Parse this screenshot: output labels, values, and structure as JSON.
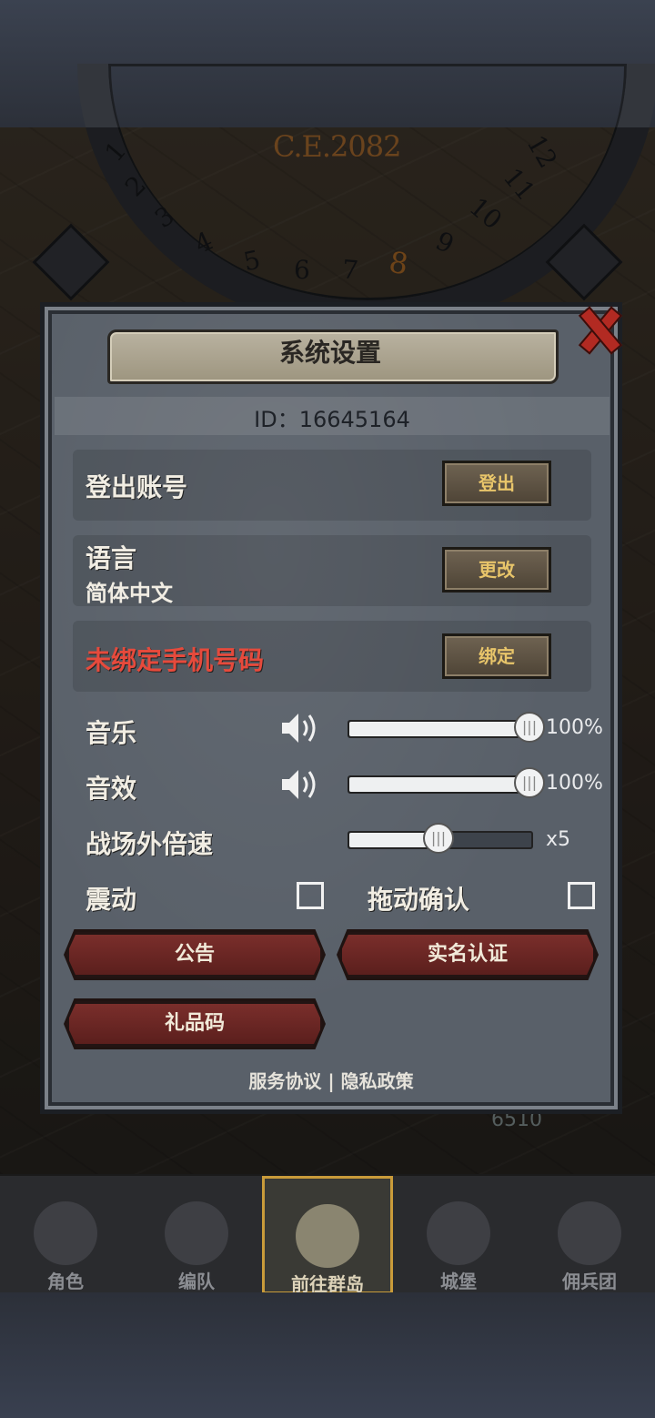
{
  "hud": {
    "era": "C.E.2082",
    "dial_numbers": [
      "1",
      "2",
      "3",
      "4",
      "5",
      "6",
      "7",
      "8",
      "9",
      "10",
      "11",
      "12"
    ],
    "current_month": "8",
    "resource_value": "6510"
  },
  "dialog": {
    "title": "系统设置",
    "id_text": "ID：16645164",
    "rows": {
      "logout": {
        "label": "登出账号",
        "button": "登出"
      },
      "language": {
        "label": "语言",
        "value": "简体中文",
        "button": "更改"
      },
      "phone": {
        "label": "未绑定手机号码",
        "button": "绑定"
      }
    },
    "music": {
      "label": "音乐",
      "level_percent": 100,
      "value_text": "100%"
    },
    "sfx": {
      "label": "音效",
      "level_percent": 100,
      "value_text": "100%"
    },
    "speed": {
      "label": "战场外倍速",
      "level_fraction": 0.5,
      "value_text": "x5"
    },
    "vibrate": {
      "label": "震动",
      "checked": false
    },
    "drag_confirm": {
      "label": "拖动确认",
      "checked": false
    },
    "buttons": {
      "notice": "公告",
      "real_name": "实名认证",
      "gift_code": "礼品码"
    },
    "links": {
      "terms": "服务协议",
      "separator": "|",
      "privacy": "隐私政策"
    }
  },
  "nav": {
    "items": [
      "角色",
      "编队",
      "前往群岛",
      "城堡",
      "佣兵团"
    ],
    "active_index": 2
  },
  "colors": {
    "accent_gold": "#c99b3a",
    "warning_red": "#e64a3c",
    "close_red": "#b22a22"
  }
}
